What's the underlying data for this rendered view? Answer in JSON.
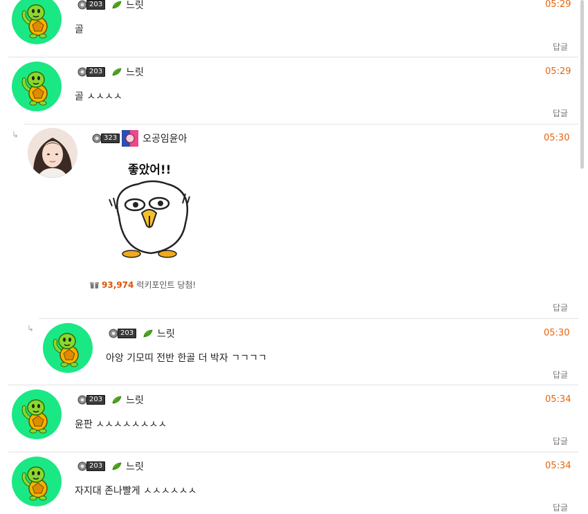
{
  "comments": [
    {
      "nick": "느릿",
      "level": "203",
      "time": "05:29",
      "text": "골",
      "reply": "답글"
    },
    {
      "nick": "느릿",
      "level": "203",
      "time": "05:29",
      "text": "골 ㅅㅅㅅㅅ",
      "reply": "답글"
    },
    {
      "nick": "오공임윤아",
      "level": "323",
      "time": "05:30",
      "sticker_text": "좋았어!!",
      "lucky_points": "93,974",
      "lucky_label": "럭키포인트 당첨!",
      "reply": "답글"
    },
    {
      "nick": "느릿",
      "level": "203",
      "time": "05:30",
      "text": "아앙 기모띠 전반 한골 더 박자 ㄱㄱㄱㄱ",
      "reply": "답글"
    },
    {
      "nick": "느릿",
      "level": "203",
      "time": "05:34",
      "text": "윤판 ㅅㅅㅅㅅㅅㅅㅅㅅ",
      "reply": "답글"
    },
    {
      "nick": "느릿",
      "level": "203",
      "time": "05:34",
      "text": "자지대 존나빨게 ㅅㅅㅅㅅㅅㅅ",
      "reply": "답글"
    }
  ],
  "reply_arrow_glyph": "↳",
  "icons": {
    "turtle_avatar": "turtle-avatar-icon",
    "level_gear": "gear-icon",
    "leaf": "leaf-icon",
    "gift": "gift-icon"
  },
  "colors": {
    "time": "#e8630a",
    "avatar_bg": "#1ae884",
    "points": "#d9530a"
  }
}
